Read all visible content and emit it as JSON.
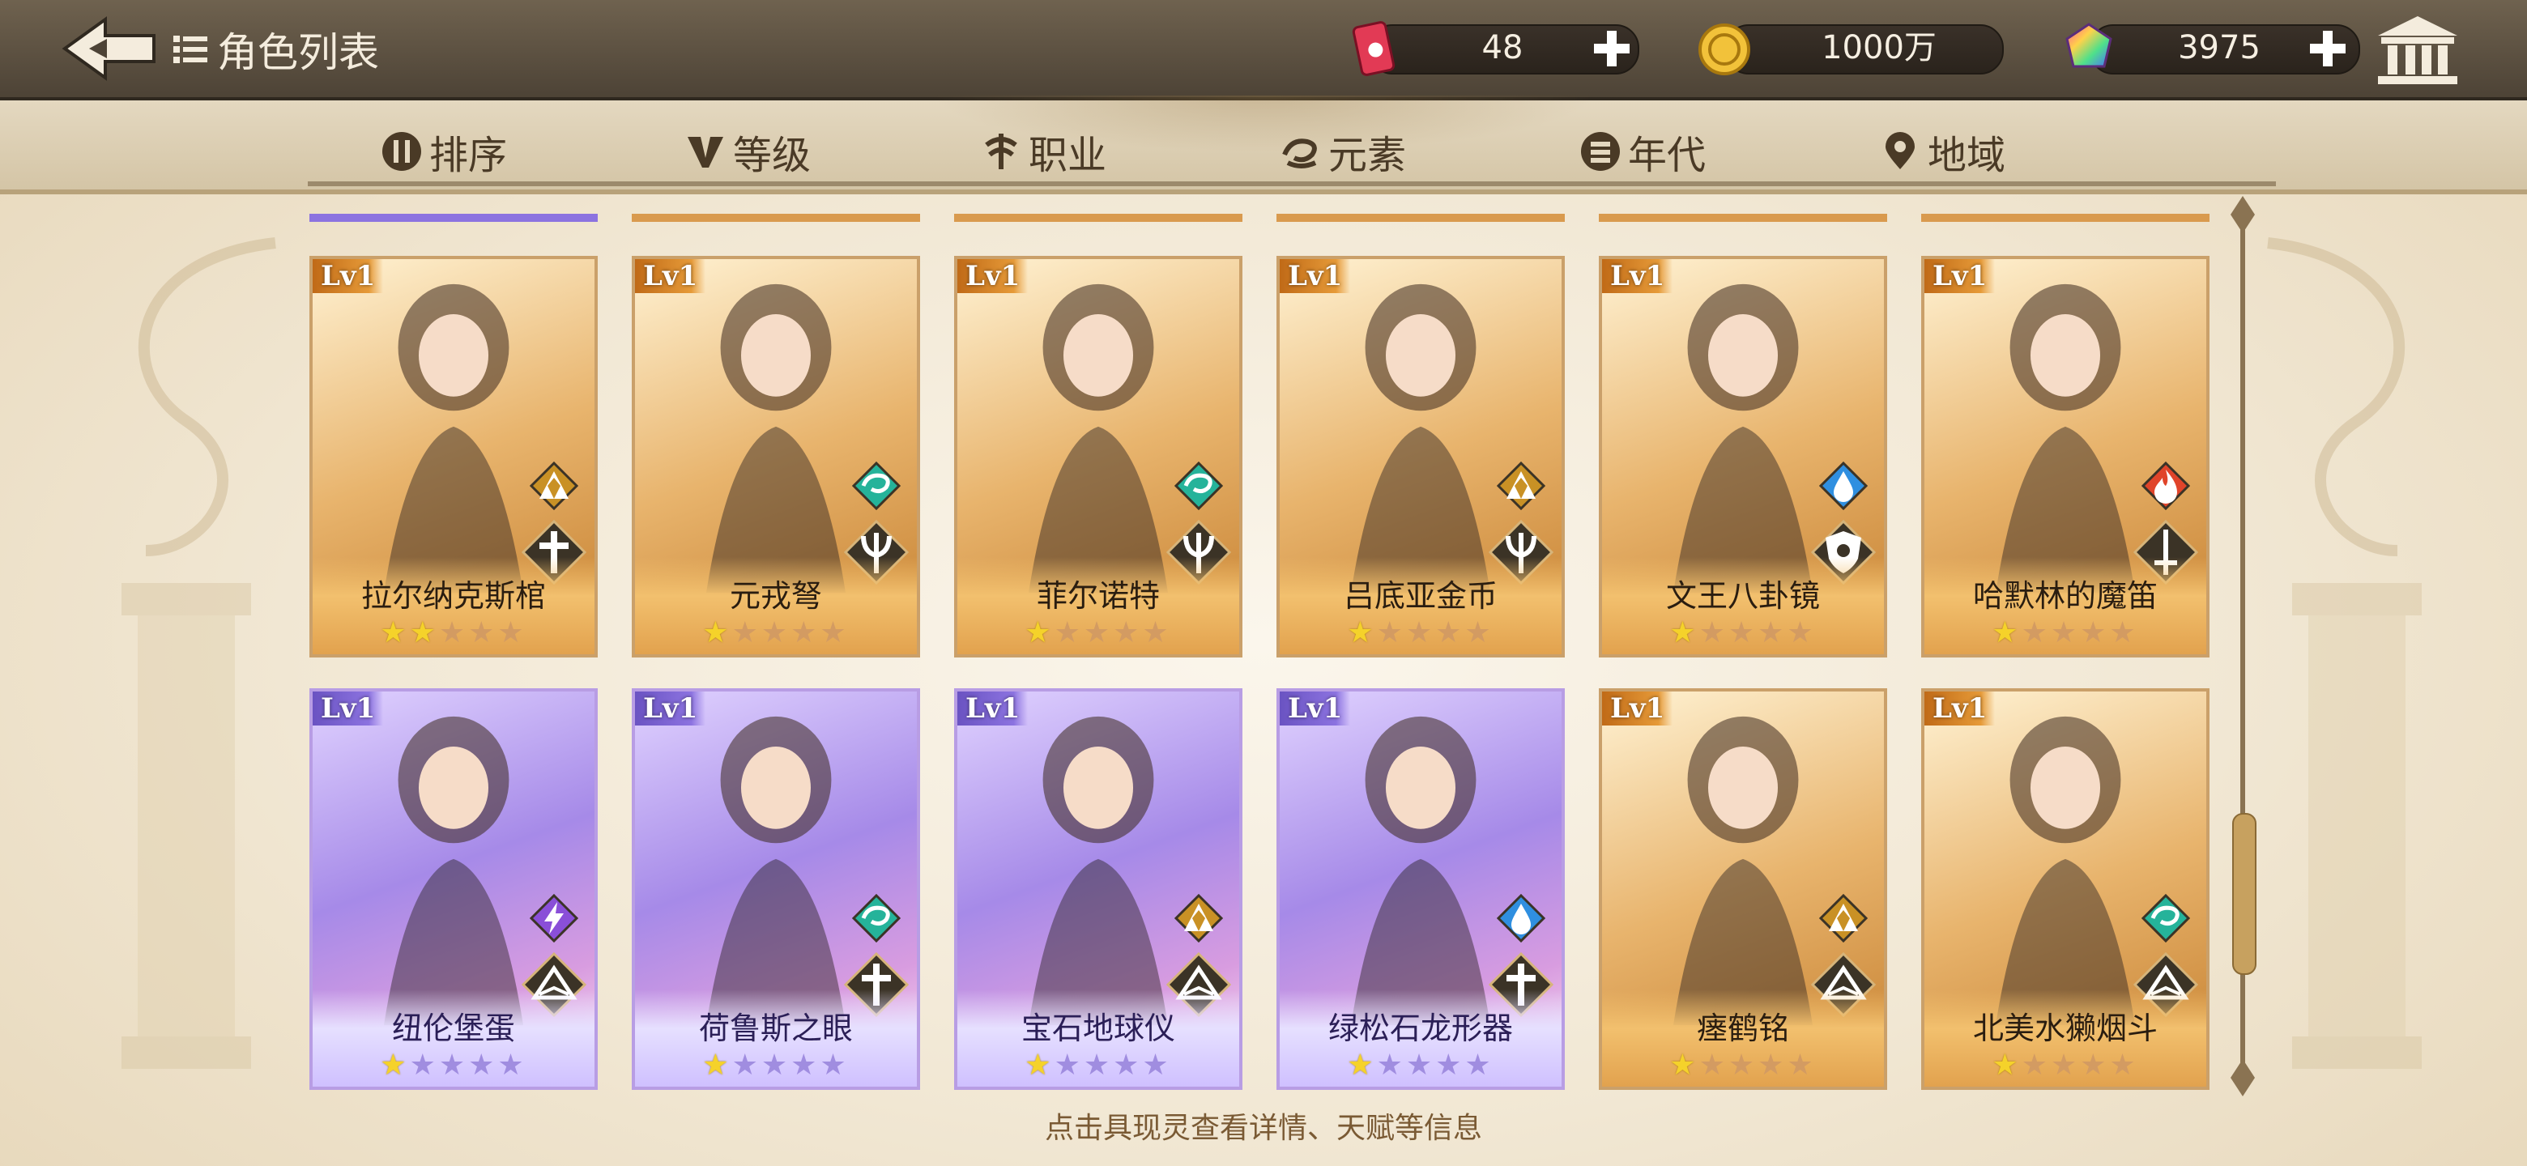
{
  "header": {
    "title": "角色列表",
    "resources": [
      {
        "icon": "soda-can-icon",
        "value": "48"
      },
      {
        "icon": "gold-coin-icon",
        "value": "1000万"
      },
      {
        "icon": "rainbow-gem-icon",
        "value": "3975"
      }
    ]
  },
  "tabs": [
    {
      "label": "排序",
      "icon": "sort-icon"
    },
    {
      "label": "等级",
      "icon": "v-level-icon"
    },
    {
      "label": "职业",
      "icon": "class-icon"
    },
    {
      "label": "元素",
      "icon": "element-icon"
    },
    {
      "label": "年代",
      "icon": "era-icon"
    },
    {
      "label": "地域",
      "icon": "location-pin-icon"
    }
  ],
  "cards": [
    {
      "level": "Lv1",
      "name": "拉尔纳克斯棺",
      "stars": 2,
      "rarity": "gold",
      "element": "earth-icon",
      "class": "cross-class-icon"
    },
    {
      "level": "Lv1",
      "name": "元戎弩",
      "stars": 1,
      "rarity": "gold",
      "element": "wind-icon",
      "class": "trident-class-icon"
    },
    {
      "level": "Lv1",
      "name": "菲尔诺特",
      "stars": 1,
      "rarity": "gold",
      "element": "wind-icon",
      "class": "trident-class-icon"
    },
    {
      "level": "Lv1",
      "name": "吕底亚金币",
      "stars": 1,
      "rarity": "gold",
      "element": "earth-icon",
      "class": "trident-class-icon"
    },
    {
      "level": "Lv1",
      "name": "文王八卦镜",
      "stars": 1,
      "rarity": "gold",
      "element": "water-icon",
      "class": "shield-class-icon"
    },
    {
      "level": "Lv1",
      "name": "哈默林的魔笛",
      "stars": 1,
      "rarity": "gold",
      "element": "fire-icon",
      "class": "sword-class-icon"
    },
    {
      "level": "Lv1",
      "name": "纽伦堡蛋",
      "stars": 1,
      "rarity": "purple",
      "element": "lightning-icon",
      "class": "book-class-icon"
    },
    {
      "level": "Lv1",
      "name": "荷鲁斯之眼",
      "stars": 1,
      "rarity": "purple",
      "element": "wind-icon",
      "class": "cross-class-icon"
    },
    {
      "level": "Lv1",
      "name": "宝石地球仪",
      "stars": 1,
      "rarity": "purple",
      "element": "earth-icon",
      "class": "book-class-icon"
    },
    {
      "level": "Lv1",
      "name": "绿松石龙形器",
      "stars": 1,
      "rarity": "purple",
      "element": "water-icon",
      "class": "cross-class-icon"
    },
    {
      "level": "Lv1",
      "name": "瘗鹤铭",
      "stars": 1,
      "rarity": "gold",
      "element": "earth-icon",
      "class": "book-class-icon"
    },
    {
      "level": "Lv1",
      "name": "北美水獭烟斗",
      "stars": 1,
      "rarity": "gold",
      "element": "wind-icon",
      "class": "book-class-icon"
    }
  ],
  "footer": {
    "hint": "点击具现灵查看详情、天赋等信息"
  },
  "colors": {
    "gold_card": "#e8b46d",
    "purple_card": "#a68ae8",
    "active_tab": "#8c73e0",
    "topbar": "#4d4336"
  }
}
